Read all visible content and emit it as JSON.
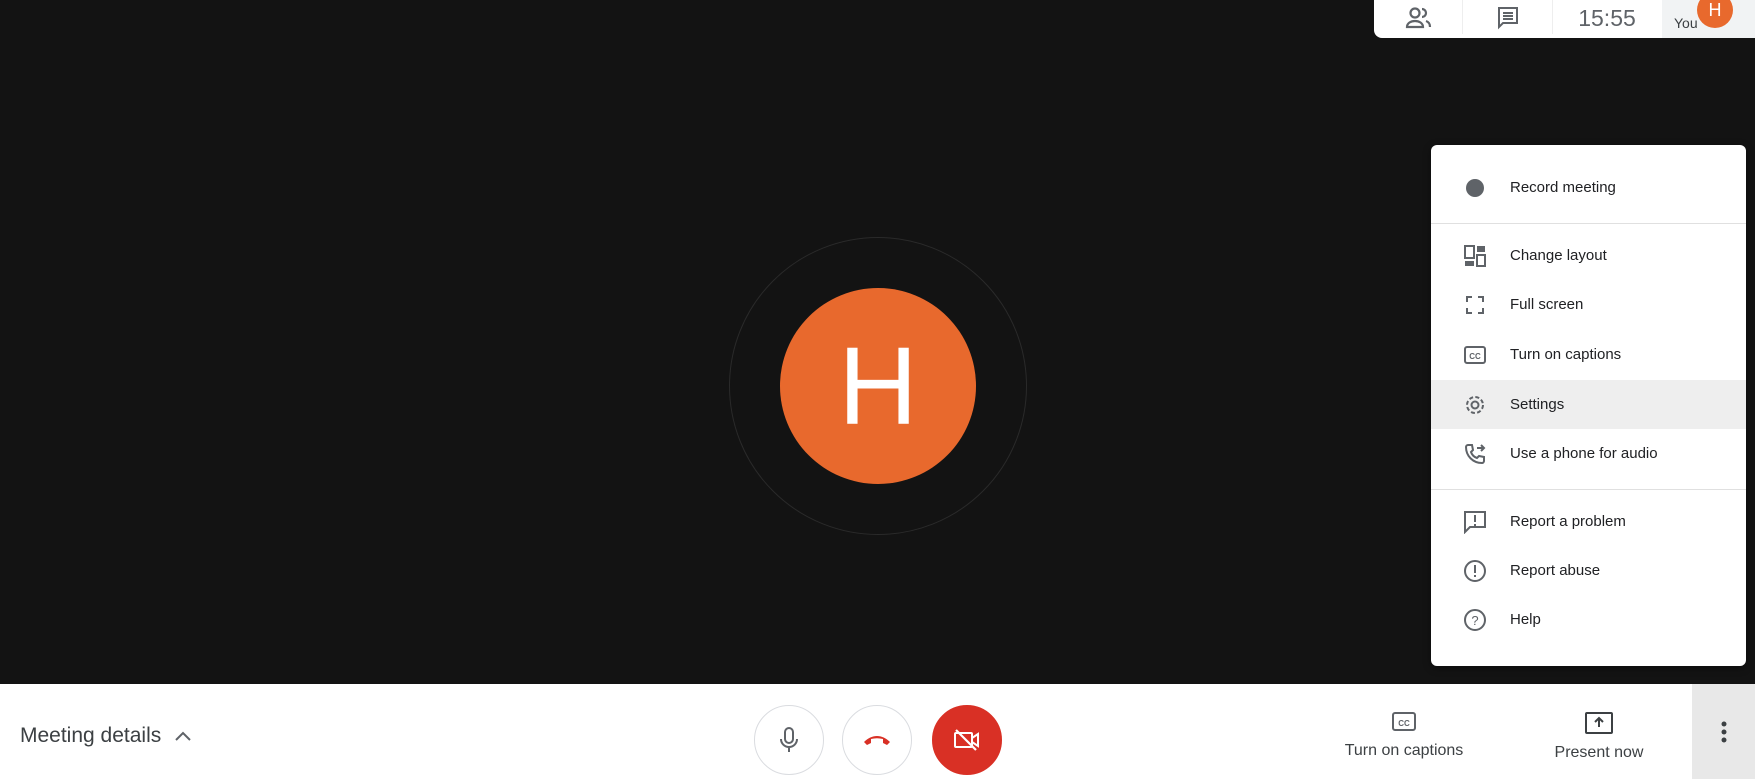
{
  "top_bar": {
    "people_icon": "people-icon",
    "chat_icon": "chat-icon",
    "time": "15:55",
    "you_label": "You",
    "avatar_initial": "H"
  },
  "main": {
    "participant_initial": "H",
    "avatar_color": "#e8692d"
  },
  "menu": {
    "items": [
      {
        "label": "Record meeting",
        "icon": "record-icon"
      },
      {
        "label": "Change layout",
        "icon": "layout-icon"
      },
      {
        "label": "Full screen",
        "icon": "fullscreen-icon"
      },
      {
        "label": "Turn on captions",
        "icon": "captions-icon"
      },
      {
        "label": "Settings",
        "icon": "gear-icon",
        "highlighted": true
      },
      {
        "label": "Use a phone for audio",
        "icon": "phone-icon"
      },
      {
        "label": "Report a problem",
        "icon": "report-problem-icon"
      },
      {
        "label": "Report abuse",
        "icon": "report-abuse-icon"
      },
      {
        "label": "Help",
        "icon": "help-icon"
      }
    ]
  },
  "bottom_bar": {
    "meeting_details": "Meeting details",
    "captions_label": "Turn on captions",
    "present_label": "Present now",
    "hangup_color": "#d93025"
  }
}
